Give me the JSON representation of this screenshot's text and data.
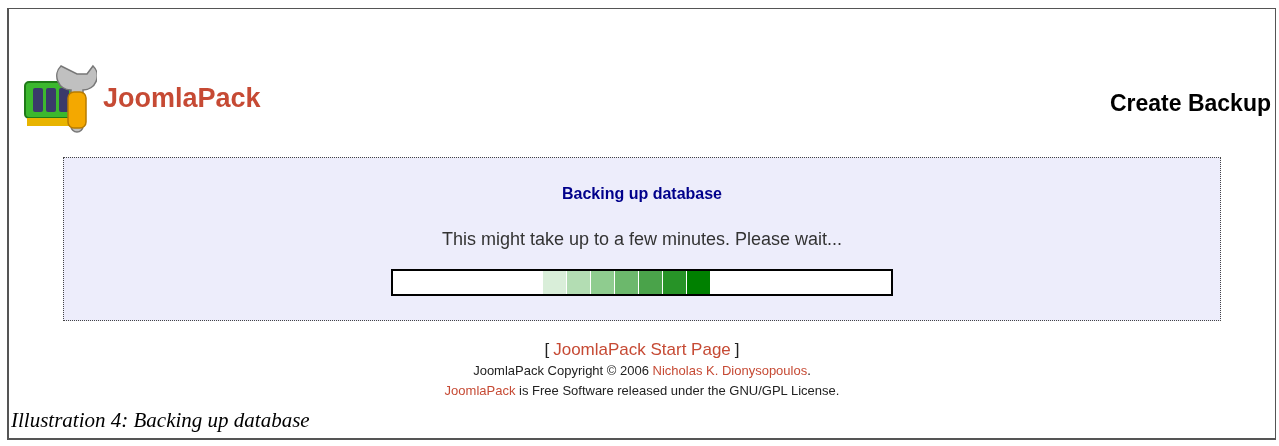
{
  "header": {
    "logo_text": "JoomlaPack",
    "page_title": "Create Backup"
  },
  "panel": {
    "heading": "Backing up database",
    "message": "This might take up to a few minutes. Please wait...",
    "progress": {
      "segments": [
        {
          "color": "#d9eed9"
        },
        {
          "color": "#b3ddb3"
        },
        {
          "color": "#8fcc8f"
        },
        {
          "color": "#6cb86c"
        },
        {
          "color": "#4aa34a"
        },
        {
          "color": "#279327"
        },
        {
          "color": "#008000"
        }
      ]
    }
  },
  "footer": {
    "start_link": {
      "open": "[",
      "label": "JoomlaPack Start Page",
      "close": "]"
    },
    "copyright": {
      "text": "JoomlaPack Copyright © 2006",
      "author_link": "Nicholas K. Dionysopoulos",
      "end": "."
    },
    "license": {
      "link": "JoomlaPack",
      "text": "is Free Software released under the GNU/GPL License."
    }
  },
  "caption": "Illustration 4: Backing up database"
}
